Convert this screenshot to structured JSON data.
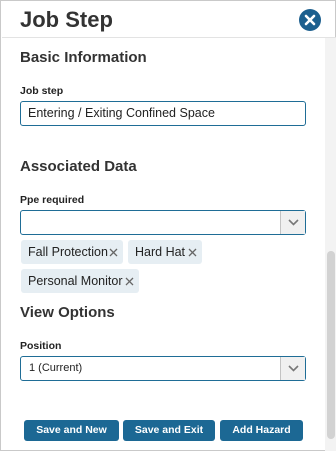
{
  "dialog": {
    "title": "Job Step",
    "close_icon": "close-circle-icon"
  },
  "basic_info": {
    "heading": "Basic Information",
    "job_step_label": "Job step",
    "job_step_value": "Entering / Exiting Confined Space"
  },
  "associated_data": {
    "heading": "Associated Data",
    "ppe_label": "Ppe required",
    "ppe_value": "",
    "ppe_chips": [
      {
        "label": "Fall Protection"
      },
      {
        "label": "Hard Hat"
      },
      {
        "label": "Personal Monitor"
      }
    ]
  },
  "view_options": {
    "heading": "View Options",
    "position_label": "Position",
    "position_value": "1 (Current)"
  },
  "actions": {
    "save_new": "Save and New",
    "save_exit": "Save and Exit",
    "add_hazard": "Add Hazard"
  },
  "colors": {
    "accent": "#1c6894",
    "chip_bg": "#e6eef3"
  }
}
